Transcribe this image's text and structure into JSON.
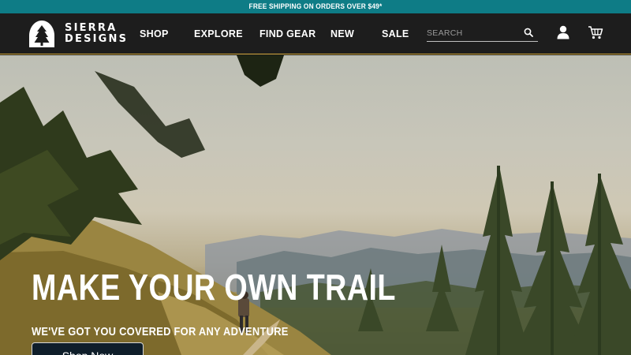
{
  "promo": {
    "text": "FREE SHIPPING ON ORDERS OVER $49*"
  },
  "brand": {
    "line1": "SIERRA",
    "line2": "DESIGNS"
  },
  "nav": [
    {
      "label": "SHOP"
    },
    {
      "label": "EXPLORE"
    },
    {
      "label": "FIND GEAR"
    },
    {
      "label": "NEW"
    },
    {
      "label": "SALE"
    }
  ],
  "search": {
    "placeholder": "SEARCH",
    "value": ""
  },
  "icons": {
    "search": "search-icon",
    "account": "user-icon",
    "cart": "cart-icon",
    "logo": "tree-tent-logo-icon"
  },
  "colors": {
    "promo_bg": "#0e7c86",
    "header_bg": "#1d1d1d",
    "header_accent": "#d4a93a",
    "cta_bg": "#0f1e2a"
  },
  "hero": {
    "title": "MAKE YOUR OWN TRAIL",
    "subtitle": "WE'VE GOT YOU COVERED FOR ANY ADVENTURE",
    "cta_label": "Shop Now"
  }
}
